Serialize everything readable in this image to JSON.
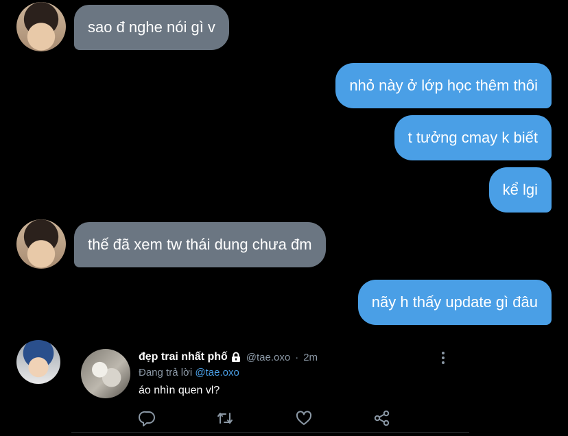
{
  "messages": [
    {
      "text": "sao đ nghe nói gì v"
    },
    {
      "text": "nhỏ này ở lớp học thêm thôi"
    },
    {
      "text": "t tưởng cmay k biết"
    },
    {
      "text": "kể lgi"
    },
    {
      "text": "thế đã xem tw thái dung chưa đm"
    },
    {
      "text": "nãy h thấy update gì đâu"
    }
  ],
  "tweet": {
    "display_name": "đẹp trai nhất phố",
    "handle": "@tae.oxo",
    "separator": "·",
    "time": "2m",
    "reply_prefix": "Đang trả lời",
    "reply_mention": "@tae.oxo",
    "text": "áo nhìn quen vl?"
  },
  "icons": {
    "lock": "lock-icon",
    "more": "more-vertical-icon",
    "reply": "reply-icon",
    "retweet": "retweet-icon",
    "like": "heart-icon",
    "share": "share-icon"
  },
  "colors": {
    "incoming_bubble": "#6b7682",
    "outgoing_bubble": "#4a9fe6",
    "muted_text": "#8b98a5",
    "background": "#000000"
  }
}
